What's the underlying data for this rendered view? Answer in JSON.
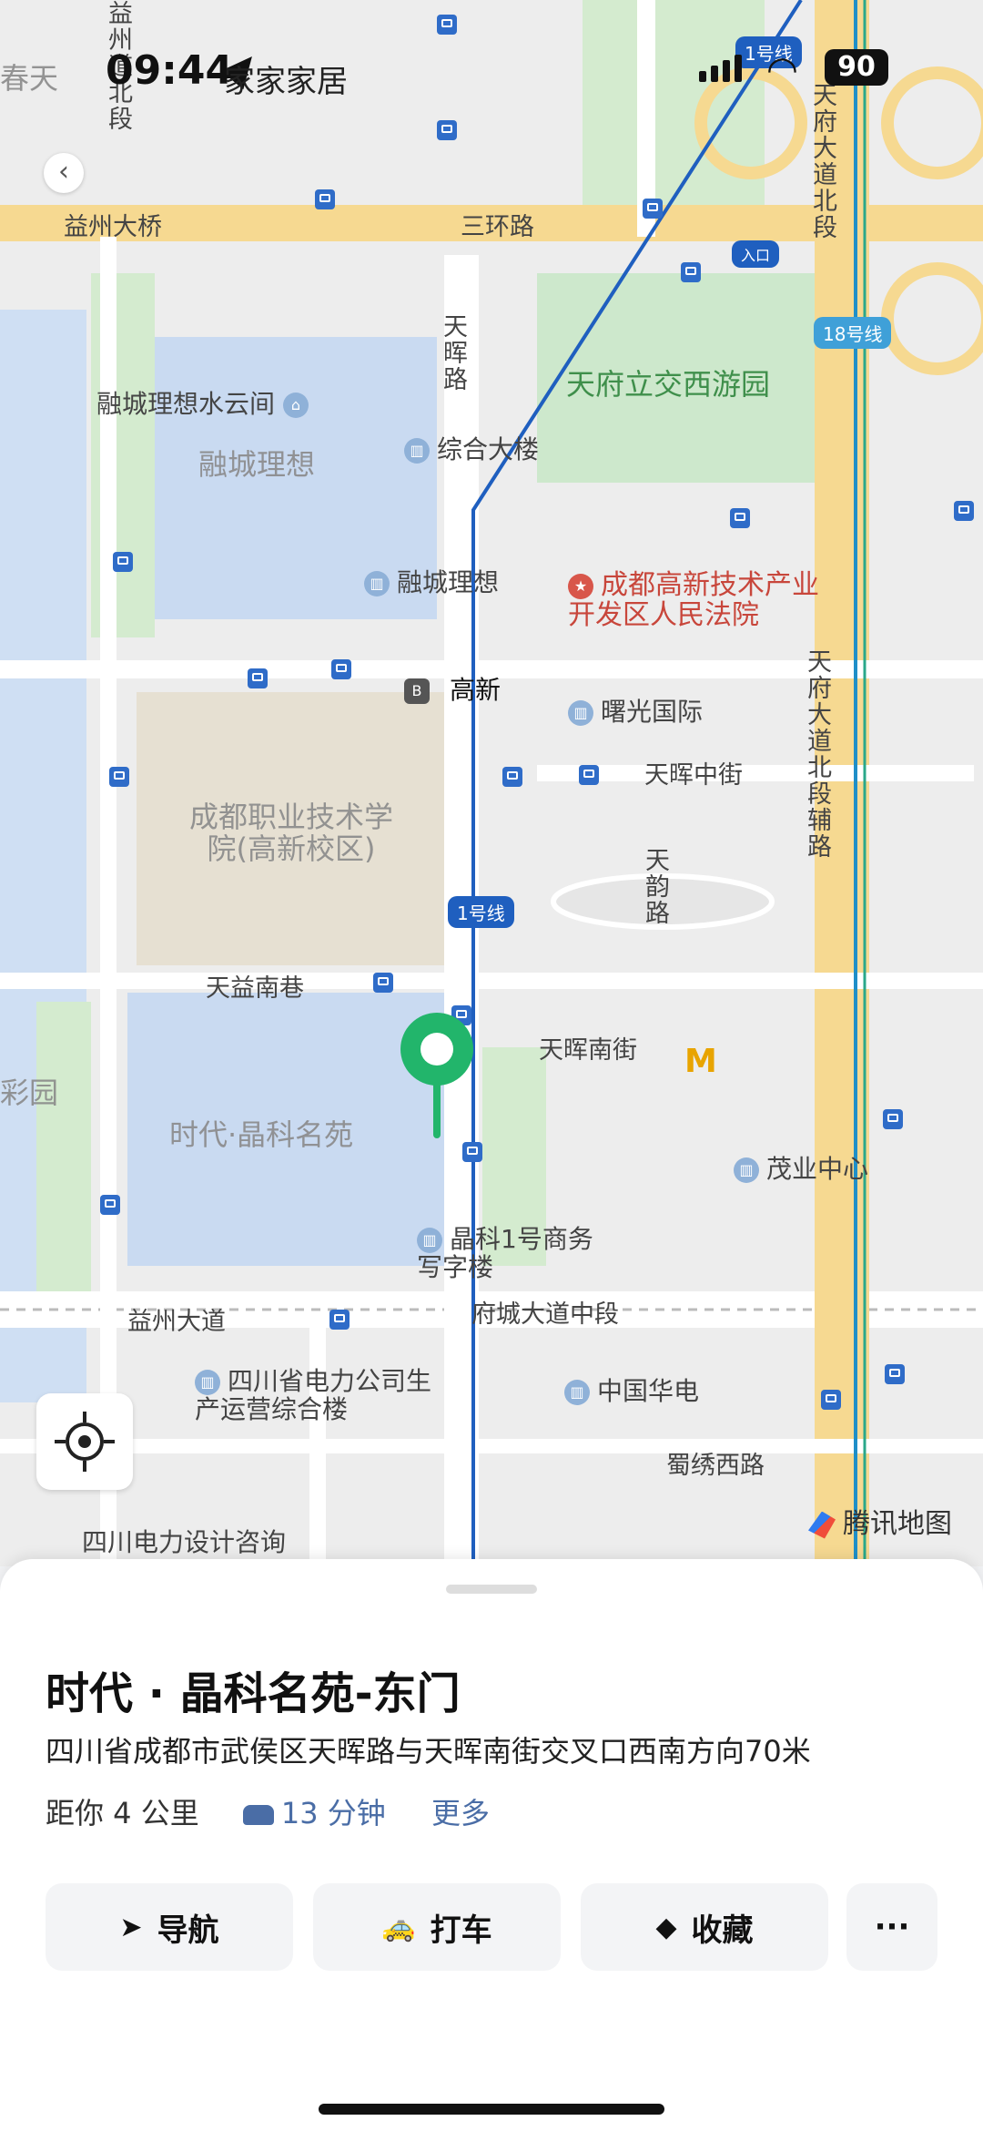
{
  "status_bar": {
    "time": "09:44",
    "back_app": "家家家居",
    "battery": "90"
  },
  "map": {
    "roads": {
      "yizhou_bridge": "益州大桥",
      "third_ring": "三环路",
      "tianhui_road": "天晖路",
      "yizhou_north": "益州道北段",
      "tianfu_avenue_north": "天府大道北段",
      "tianfu_avenue_aux": "天府大道北段辅路",
      "tianhui_middle": "天晖中街",
      "tianyun_road": "天韵路",
      "tianyi_south_lane": "天益南巷",
      "tianhui_south": "天晖南街",
      "yizhou_avenue": "益州大道",
      "fucheng_avenue": "府城大道中段",
      "shuxiu_west": "蜀绣西路"
    },
    "areas": {
      "rongcheng_lixiang": "融城理想",
      "vocational_college": "成都职业技术学院(高新校区)",
      "shidai_jingke": "时代·晶科名苑",
      "tianfu_park": "天府立交西游园",
      "spring": "春天",
      "garden_fragment": "彩园"
    },
    "pois": {
      "rongcheng_shuiyun": "融城理想水云间",
      "complex_building": "综合大楼",
      "rongcheng_lixiang_poi": "融城理想",
      "court": "成都高新技术产业开发区人民法院",
      "shuguang": "曙光国际",
      "gaoxin_station": "高新",
      "maoye": "茂业中心",
      "jingke_office": "晶科1号商务写字楼",
      "power_company": "四川省电力公司生产运营综合楼",
      "china_huadian": "中国华电",
      "power_design": "四川电力设计咨询",
      "entrance": "入口"
    },
    "metro": {
      "line1": "1号线",
      "line18": "18号线",
      "line1_top": "1号线"
    },
    "provider": "腾讯地图"
  },
  "place": {
    "title": "时代 · 晶科名苑-东门",
    "address": "四川省成都市武侯区天晖路与天晖南街交叉口西南方向70米",
    "distance": "距你 4 公里",
    "drive_time": "13 分钟",
    "more": "更多"
  },
  "actions": {
    "navigate": "导航",
    "taxi": "打车",
    "favorite": "收藏",
    "more": "···"
  }
}
